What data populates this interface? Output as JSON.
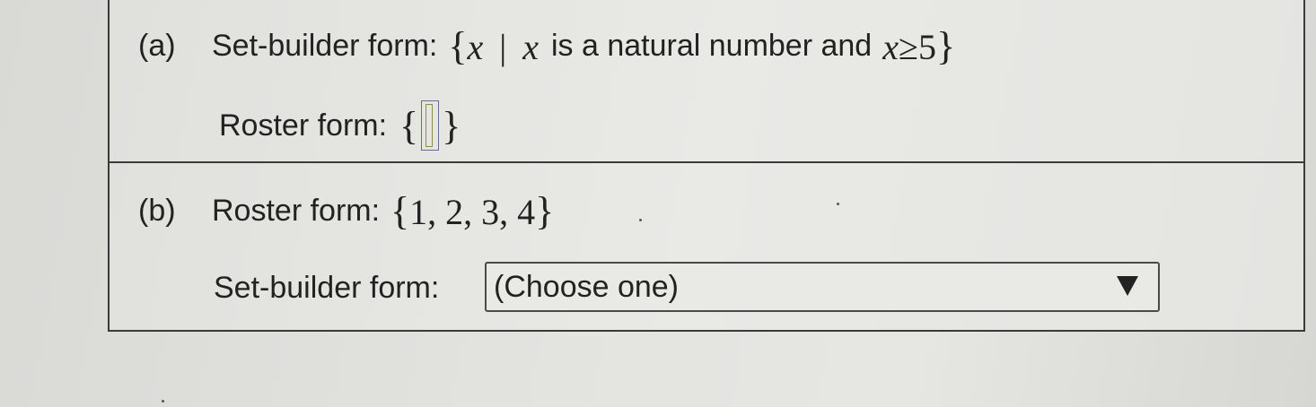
{
  "part_a": {
    "label": "(a)",
    "setbuilder_label": "Set-builder form:",
    "set_var": "x",
    "set_bar": "|",
    "set_cond_var": "x",
    "set_cond_text": "is a natural number and",
    "set_cond_var2": "x",
    "set_cond_rel": "≥",
    "set_cond_num": "5",
    "open_brace": "{",
    "close_brace": "}",
    "roster_label": "Roster form:"
  },
  "part_b": {
    "label": "(b)",
    "roster_label": "Roster form:",
    "roster_values": "1, 2, 3, 4",
    "open_brace": "{",
    "close_brace": "}",
    "setbuilder_label": "Set-builder form:",
    "select_value": "(Choose one)"
  },
  "icons": {
    "dropdown": "triangle-down-icon"
  }
}
